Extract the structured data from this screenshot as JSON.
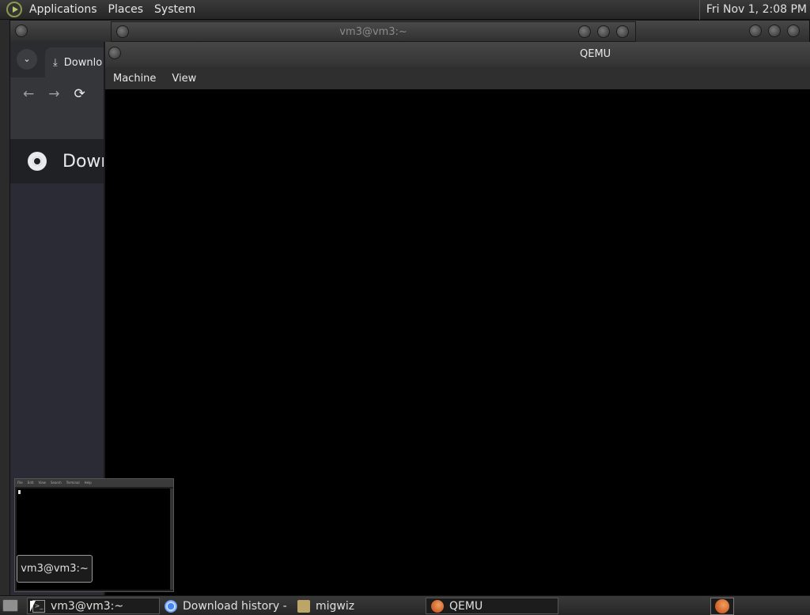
{
  "top_panel": {
    "menus": [
      "Applications",
      "Places",
      "System"
    ],
    "clock": "Fri Nov  1,  2:08 PM"
  },
  "browser": {
    "tab_title": "Downlo",
    "page_heading": "Down",
    "tab_search_icon": "chevron-down-icon",
    "nav_icons": {
      "back": "←",
      "forward": "→",
      "reload": "⟳"
    },
    "download_glyph": "⤓"
  },
  "terminal_window": {
    "title": "vm3@vm3:~"
  },
  "qemu": {
    "title": "QEMU",
    "menus": [
      "Machine",
      "View"
    ]
  },
  "preview": {
    "tooltip": "vm3@vm3:~",
    "mini_menus": [
      "File",
      "Edit",
      "View",
      "Search",
      "Terminal",
      "Help"
    ]
  },
  "taskbar": {
    "tasks": [
      {
        "label": "vm3@vm3:~",
        "icon": "terminal-icon"
      },
      {
        "label": "Download history - ...",
        "icon": "chrome-icon"
      },
      {
        "label": "migwiz",
        "icon": "folder-icon"
      },
      {
        "label": "QEMU",
        "icon": "qemu-icon"
      }
    ]
  }
}
